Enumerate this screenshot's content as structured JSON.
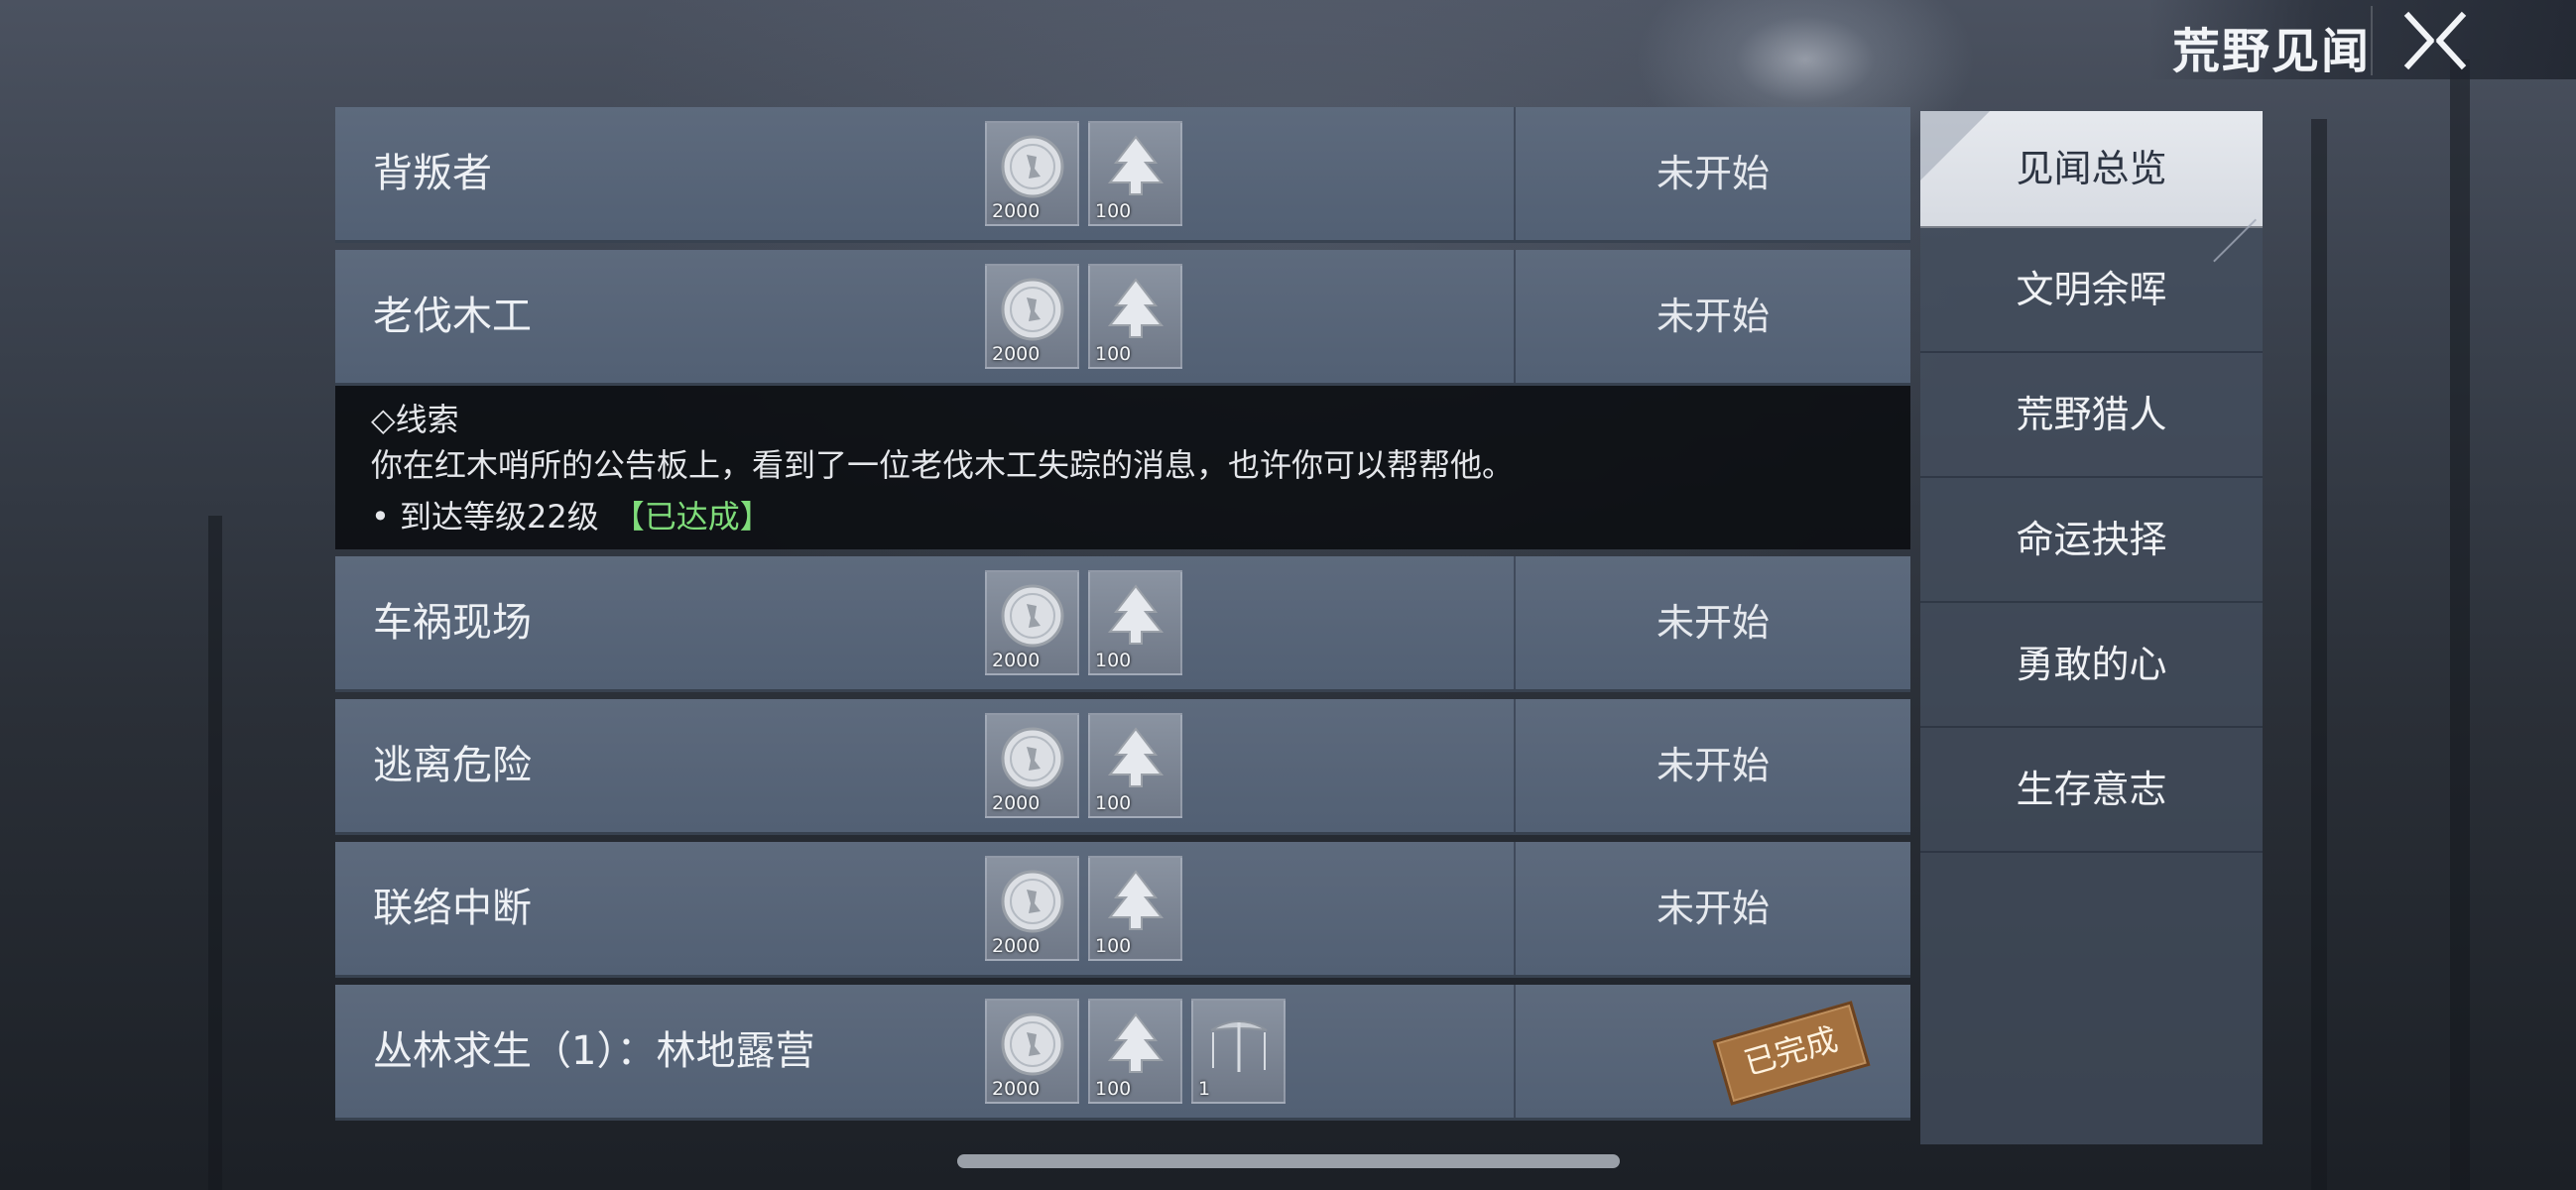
{
  "header": {
    "title": "荒野见闻",
    "close_icon": "close-icon"
  },
  "quests": [
    {
      "name": "背叛者",
      "status": "未开始",
      "rewards": [
        {
          "icon": "coin-icon",
          "qty": "2000"
        },
        {
          "icon": "tree-emblem-icon",
          "qty": "100"
        }
      ]
    },
    {
      "name": "老伐木工",
      "status": "未开始",
      "rewards": [
        {
          "icon": "coin-icon",
          "qty": "2000"
        },
        {
          "icon": "tree-emblem-icon",
          "qty": "100"
        }
      ]
    },
    {
      "name": "车祸现场",
      "status": "未开始",
      "rewards": [
        {
          "icon": "coin-icon",
          "qty": "2000"
        },
        {
          "icon": "tree-emblem-icon",
          "qty": "100"
        }
      ]
    },
    {
      "name": "逃离危险",
      "status": "未开始",
      "rewards": [
        {
          "icon": "coin-icon",
          "qty": "2000"
        },
        {
          "icon": "tree-emblem-icon",
          "qty": "100"
        }
      ]
    },
    {
      "name": "联络中断",
      "status": "未开始",
      "rewards": [
        {
          "icon": "coin-icon",
          "qty": "2000"
        },
        {
          "icon": "tree-emblem-icon",
          "qty": "100"
        }
      ]
    },
    {
      "name": "丛林求生（1）：林地露营",
      "status": "已完成",
      "rewards": [
        {
          "icon": "coin-icon",
          "qty": "2000"
        },
        {
          "icon": "tree-emblem-icon",
          "qty": "100"
        },
        {
          "icon": "umbrella-icon",
          "qty": "1"
        }
      ]
    }
  ],
  "clue": {
    "title": "◇线索",
    "text": "你在红木哨所的公告板上，看到了一位老伐木工失踪的消息，也许你可以帮帮他。",
    "requirement": "• 到达等级22级",
    "requirement_status": "【已达成】",
    "status_color": "#7fdc7a"
  },
  "nav": {
    "active_index": 0,
    "items": [
      "见闻总览",
      "文明余晖",
      "荒野猎人",
      "命运抉择",
      "勇敢的心",
      "生存意志"
    ]
  }
}
